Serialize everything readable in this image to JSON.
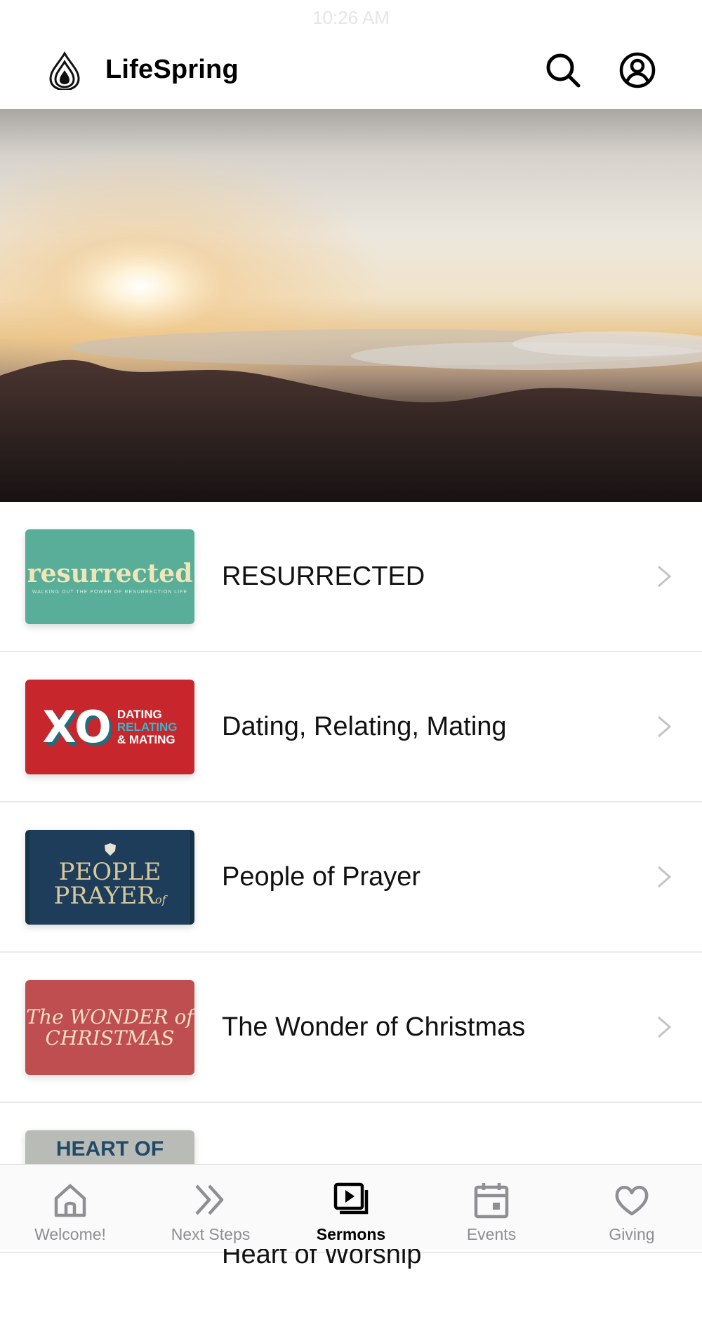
{
  "status_bar": {
    "time": "10:26 AM"
  },
  "header": {
    "app_name": "LifeSpring"
  },
  "series": [
    {
      "title": "RESURRECTED",
      "thumb_text": "resurrected",
      "thumb_sub": "WALKING OUT THE POWER OF RESURRECTION LIFE"
    },
    {
      "title": "Dating, Relating, Mating",
      "thumb_xo": "XO",
      "thumb_line1": "DATING",
      "thumb_line2": "RELATING",
      "thumb_line3": "& MATING"
    },
    {
      "title": "People of Prayer",
      "thumb_line1": "PEOPLE",
      "thumb_line2": "PRAYER",
      "thumb_of": "of"
    },
    {
      "title": "The Wonder of Christmas",
      "thumb_line1": "The WONDER of",
      "thumb_line2": "CHRISTMAS"
    },
    {
      "title": "Heart of Worship",
      "thumb_text": "HEART OF"
    }
  ],
  "tabs": [
    {
      "label": "Welcome!",
      "icon": "home-icon",
      "active": false
    },
    {
      "label": "Next Steps",
      "icon": "double-chevron-icon",
      "active": false
    },
    {
      "label": "Sermons",
      "icon": "video-library-icon",
      "active": true
    },
    {
      "label": "Events",
      "icon": "calendar-icon",
      "active": false
    },
    {
      "label": "Giving",
      "icon": "heart-icon",
      "active": false
    }
  ],
  "colors": {
    "active_tab": "#000000",
    "inactive_tab": "#8e8e93",
    "chevron": "#c4c4c4"
  }
}
